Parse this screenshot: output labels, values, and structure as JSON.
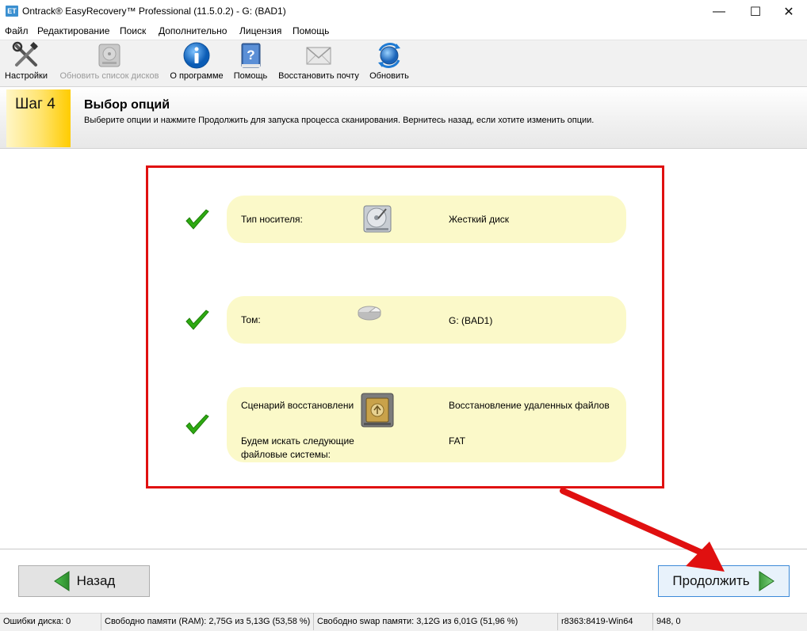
{
  "window": {
    "icon_text": "ET",
    "title": "Ontrack® EasyRecovery™ Professional (11.5.0.2) - G: (BAD1)",
    "minimize": "—",
    "maximize": "☐",
    "close": "✕"
  },
  "menu": [
    "Файл",
    "Редактирование",
    "Поиск",
    "Дополнительно",
    "Лицензия",
    "Помощь"
  ],
  "toolbar": [
    {
      "label": "Настройки",
      "icon": "settings-tools-icon",
      "enabled": true
    },
    {
      "label": "Обновить список дисков",
      "icon": "refresh-disks-icon",
      "enabled": false
    },
    {
      "label": "О программе",
      "icon": "info-icon",
      "enabled": true
    },
    {
      "label": "Помощь",
      "icon": "help-book-icon",
      "enabled": true
    },
    {
      "label": "Восстановить почту",
      "icon": "mail-envelope-icon",
      "enabled": true
    },
    {
      "label": "Обновить",
      "icon": "update-globe-icon",
      "enabled": true
    }
  ],
  "step": {
    "badge": "Шаг 4",
    "title": "Выбор опций",
    "subtitle": "Выберите опции и нажмите Продолжить для запуска процесса сканирования. Вернитесь назад, если хотите изменить опции."
  },
  "options": [
    {
      "label": "Тип носителя:",
      "icon": "hard-drive-icon",
      "value": "Жесткий диск"
    },
    {
      "label": "Том:",
      "icon": "volume-icon",
      "value": "G: (BAD1)"
    },
    {
      "label": "Сценарий восстановлени",
      "icon": "recovery-scenario-icon",
      "value": "Восстановление удаленных файлов",
      "label2": "Будем искать следующие",
      "label3": "файловые системы:",
      "value2": "FAT"
    }
  ],
  "colors": {
    "accent": "#3c8ad8",
    "annotation_red": "#e01010",
    "option_bg": "#fbf9c9",
    "check_green": "#2eaa12"
  },
  "buttons": {
    "back": "Назад",
    "continue": "Продолжить"
  },
  "status": {
    "disk_errors": "Ошибки диска: 0",
    "ram": "Свободно памяти (RAM): 2,75G из 5,13G (53,58 %)",
    "swap": "Свободно swap памяти: 3,12G из 6,01G (51,96 %)",
    "build": "r8363:8419-Win64",
    "coords": "948, 0"
  }
}
